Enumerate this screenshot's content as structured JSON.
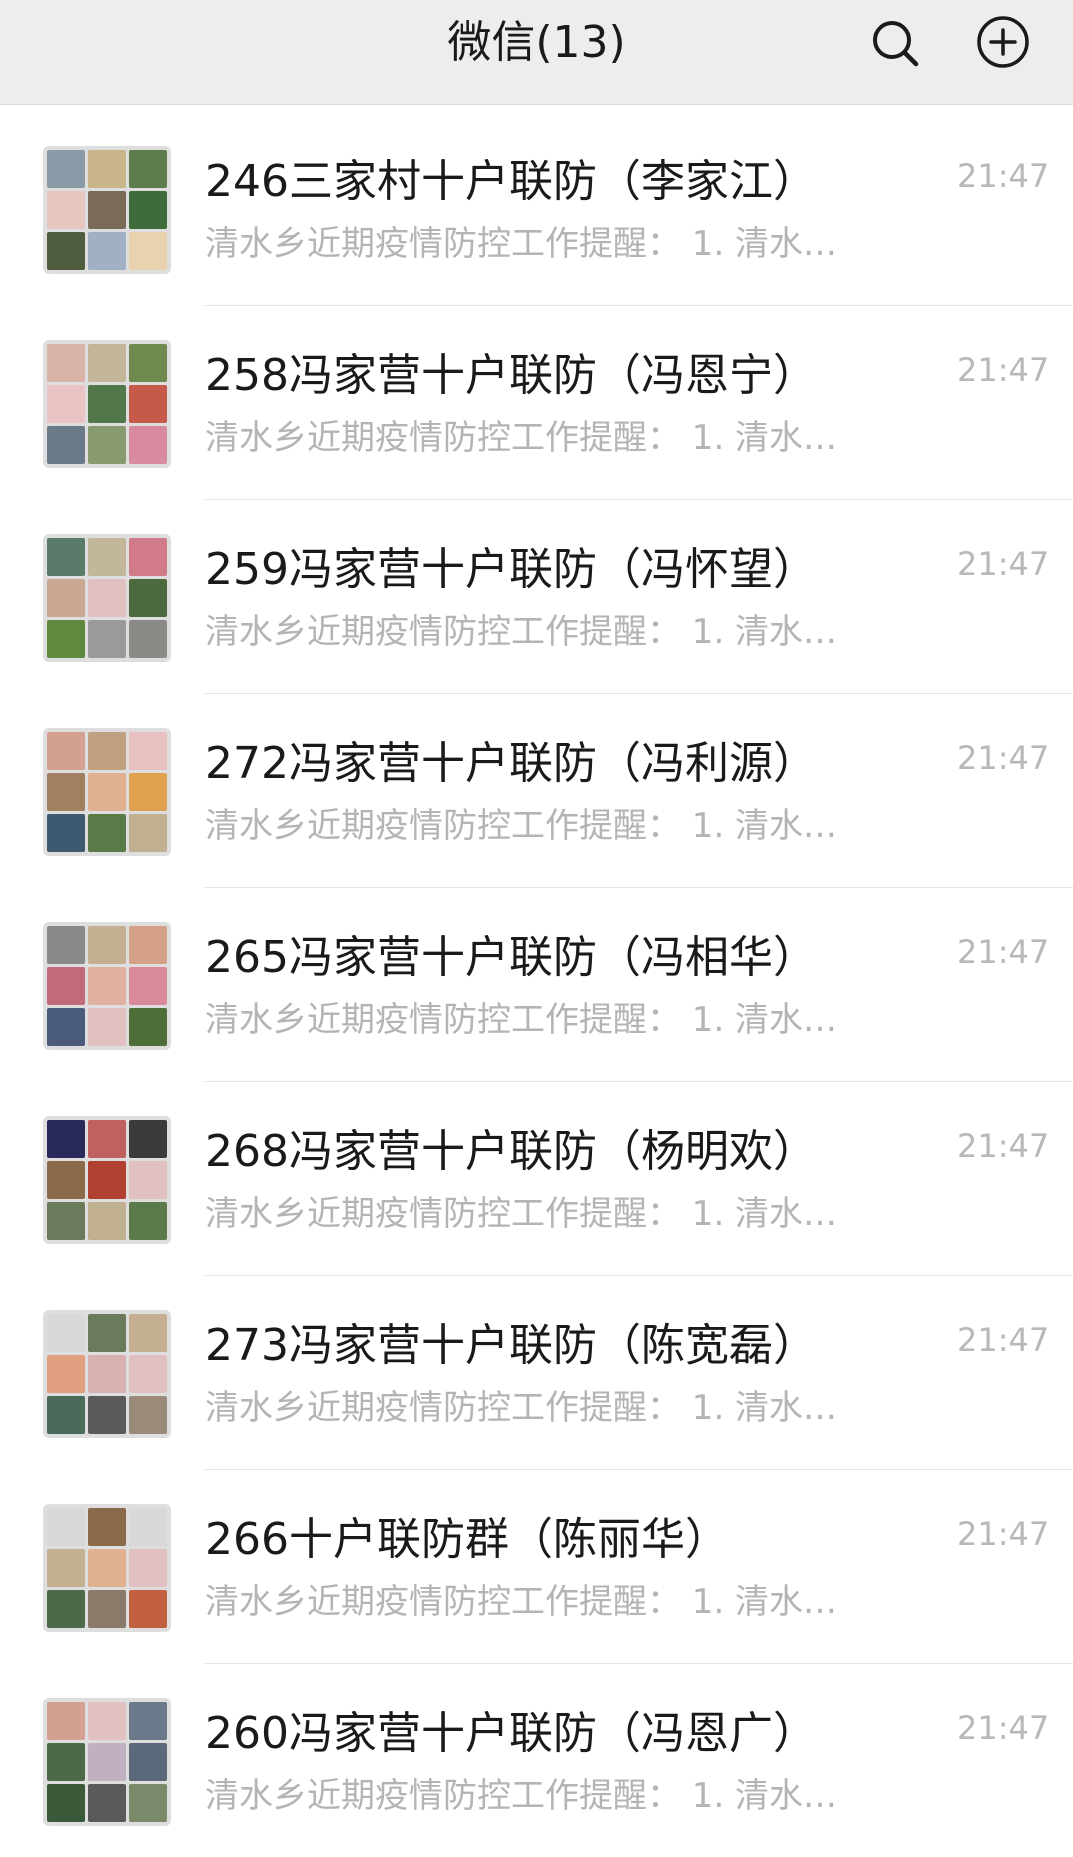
{
  "header": {
    "title": "微信(13)",
    "search_icon": "search-icon",
    "add_icon": "plus-circle-icon"
  },
  "colors": {
    "header_bg": "#ededed",
    "title": "#1a1a1a",
    "preview": "#b4b4b4",
    "time": "#b8b8b8"
  },
  "chats": [
    {
      "name": "246三家村十户联防（李家江）",
      "preview": "清水乡近期疫情防控工作提醒： 1. 清水…",
      "time": "21:47"
    },
    {
      "name": "258冯家营十户联防（冯恩宁）",
      "preview": "清水乡近期疫情防控工作提醒： 1. 清水…",
      "time": "21:47"
    },
    {
      "name": "259冯家营十户联防（冯怀望）",
      "preview": "清水乡近期疫情防控工作提醒： 1. 清水…",
      "time": "21:47"
    },
    {
      "name": "272冯家营十户联防（冯利源）",
      "preview": "清水乡近期疫情防控工作提醒： 1. 清水…",
      "time": "21:47"
    },
    {
      "name": "265冯家营十户联防（冯相华）",
      "preview": "清水乡近期疫情防控工作提醒： 1. 清水…",
      "time": "21:47"
    },
    {
      "name": "268冯家营十户联防（杨明欢）",
      "preview": "清水乡近期疫情防控工作提醒： 1. 清水…",
      "time": "21:47"
    },
    {
      "name": "273冯家营十户联防（陈宽磊）",
      "preview": "清水乡近期疫情防控工作提醒： 1. 清水…",
      "time": "21:47"
    },
    {
      "name": "266十户联防群（陈丽华）",
      "preview": "清水乡近期疫情防控工作提醒： 1. 清水…",
      "time": "21:47"
    },
    {
      "name": "260冯家营十户联防（冯恩广）",
      "preview": "清水乡近期疫情防控工作提醒： 1. 清水…",
      "time": "21:47"
    }
  ]
}
